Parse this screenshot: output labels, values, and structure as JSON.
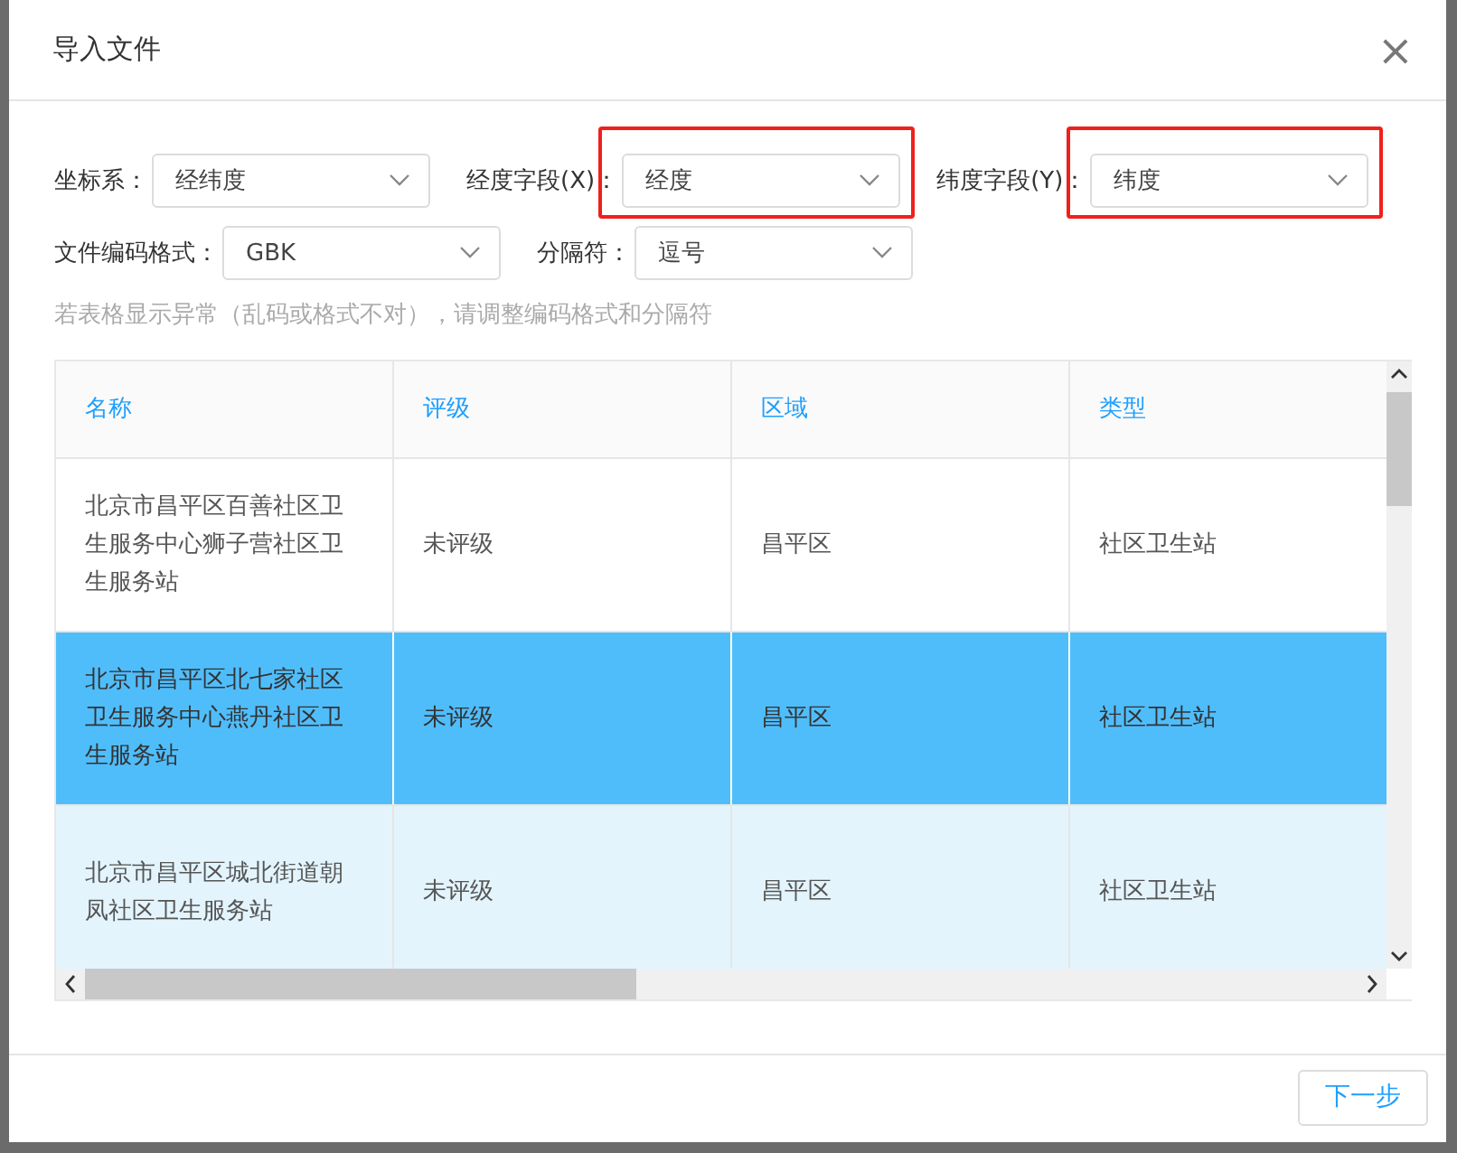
{
  "dialog": {
    "title": "导入文件",
    "close": "×"
  },
  "field_rows": [
    [
      {
        "label": "坐标系：",
        "value": "经纬度",
        "highlighted": false
      },
      {
        "label": "经度字段(X)：",
        "value": "经度",
        "highlighted": true
      },
      {
        "label": "纬度字段(Y)：",
        "value": "纬度",
        "highlighted": true
      }
    ],
    [
      {
        "label": "文件编码格式：",
        "value": "GBK",
        "highlighted": false
      },
      {
        "label": "分隔符：",
        "value": "逗号",
        "highlighted": false
      }
    ]
  ],
  "hint": "若表格显示异常（乱码或格式不对），请调整编码格式和分隔符",
  "table": {
    "columns": [
      "名称",
      "评级",
      "区域",
      "类型"
    ],
    "rows": [
      {
        "cells": [
          "北京市昌平区百善社区卫生服务中心狮子营社区卫生服务站",
          "未评级",
          "昌平区",
          "社区卫生站"
        ],
        "selected": false,
        "hovered": false
      },
      {
        "cells": [
          "北京市昌平区北七家社区卫生服务中心燕丹社区卫生服务站",
          "未评级",
          "昌平区",
          "社区卫生站"
        ],
        "selected": true,
        "hovered": false
      },
      {
        "cells": [
          "北京市昌平区城北街道朝凤社区卫生服务站",
          "未评级",
          "昌平区",
          "社区卫生站"
        ],
        "selected": false,
        "hovered": true
      }
    ]
  },
  "buttons": [
    "下一步"
  ]
}
